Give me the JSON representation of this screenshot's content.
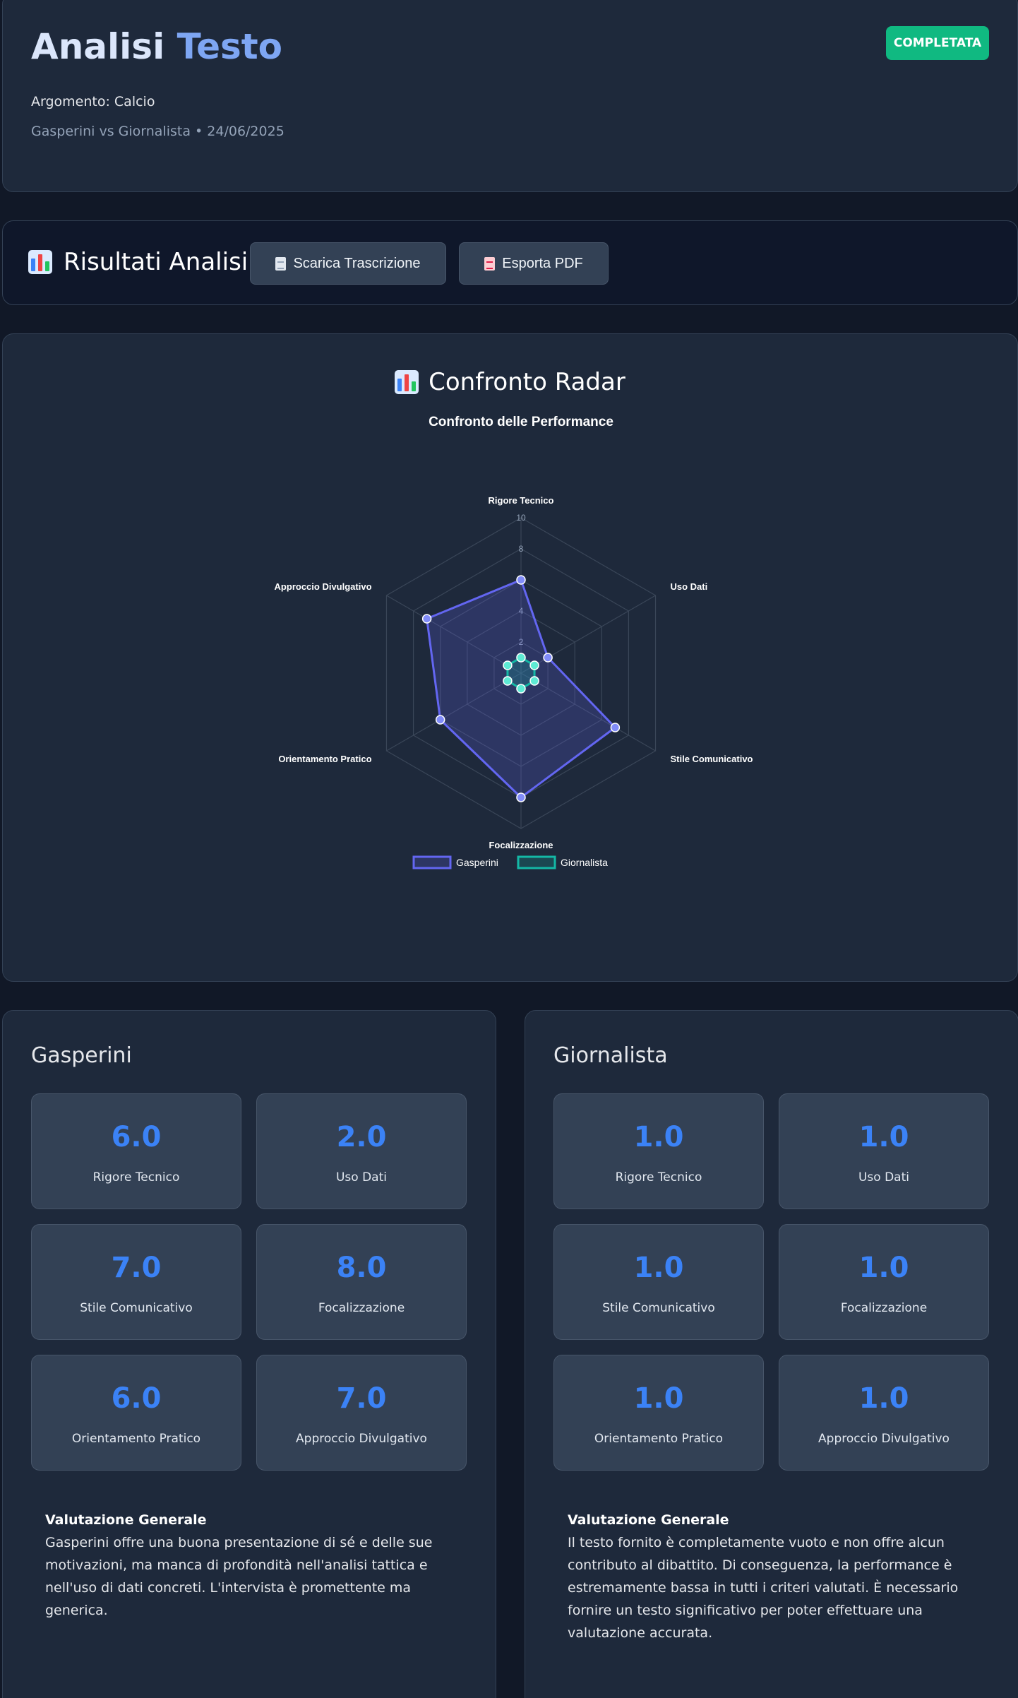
{
  "header": {
    "title_part1": "Analisi",
    "title_part2": "Testo",
    "status": "COMPLETATA",
    "topic": "Argomento: Calcio",
    "meta": "Gasperini vs Giornalista • 24/06/2025"
  },
  "toolbar": {
    "title": "Risultati Analisi",
    "download_transcript": "Scarica Trascrizione",
    "export_pdf": "Esporta PDF"
  },
  "radar_section": {
    "heading": "Confronto Radar"
  },
  "chart_data": {
    "type": "radar",
    "title": "Confronto delle Performance",
    "axes": [
      "Rigore Tecnico",
      "Uso Dati",
      "Stile Comunicativo",
      "Focalizzazione",
      "Orientamento Pratico",
      "Approccio Divulgativo"
    ],
    "rlim": [
      0,
      10
    ],
    "ticks": [
      "2",
      "4",
      "6",
      "8",
      "10"
    ],
    "legend_position": "bottom",
    "series": [
      {
        "name": "Gasperini",
        "values": [
          6,
          2,
          7,
          8,
          6,
          7
        ],
        "color": "#6366f1"
      },
      {
        "name": "Giornalista",
        "values": [
          1,
          1,
          1,
          1,
          1,
          1
        ],
        "color": "#14b8a6"
      }
    ]
  },
  "evaluations": [
    {
      "name": "Gasperini",
      "scores": [
        {
          "value": "6.0",
          "label": "Rigore Tecnico"
        },
        {
          "value": "2.0",
          "label": "Uso Dati"
        },
        {
          "value": "7.0",
          "label": "Stile Comunicativo"
        },
        {
          "value": "8.0",
          "label": "Focalizzazione"
        },
        {
          "value": "6.0",
          "label": "Orientamento Pratico"
        },
        {
          "value": "7.0",
          "label": "Approccio Divulgativo"
        }
      ],
      "summary_title": "Valutazione Generale",
      "summary_text": "Gasperini offre una buona presentazione di sé e delle sue motivazioni, ma manca di profondità nell'analisi tattica e nell'uso di dati concreti. L'intervista è promettente ma generica."
    },
    {
      "name": "Giornalista",
      "scores": [
        {
          "value": "1.0",
          "label": "Rigore Tecnico"
        },
        {
          "value": "1.0",
          "label": "Uso Dati"
        },
        {
          "value": "1.0",
          "label": "Stile Comunicativo"
        },
        {
          "value": "1.0",
          "label": "Focalizzazione"
        },
        {
          "value": "1.0",
          "label": "Orientamento Pratico"
        },
        {
          "value": "1.0",
          "label": "Approccio Divulgativo"
        }
      ],
      "summary_title": "Valutazione Generale",
      "summary_text": "Il testo fornito è completamente vuoto e non offre alcun contributo al dibattito. Di conseguenza, la performance è estremamente bassa in tutti i criteri valutati. È necessario fornire un testo significativo per poter effettuare una valutazione accurata."
    }
  ]
}
